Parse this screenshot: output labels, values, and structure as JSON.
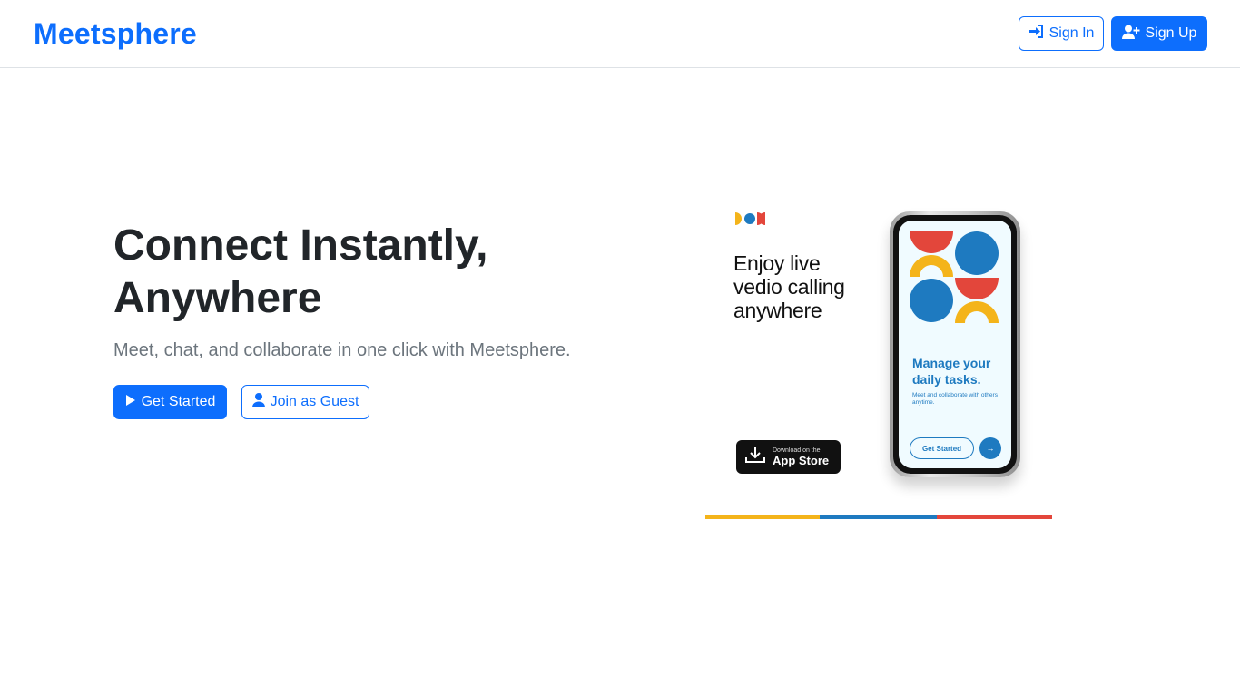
{
  "header": {
    "brand": "Meetsphere",
    "sign_in_label": "Sign In",
    "sign_up_label": "Sign Up"
  },
  "hero": {
    "title_line1": "Connect Instantly,",
    "title_line2": "Anywhere",
    "subtitle": "Meet, chat, and collaborate in one click with Meetsphere.",
    "get_started_label": "Get Started",
    "join_guest_label": "Join as Guest"
  },
  "promo": {
    "heading_line1": "Enjoy live",
    "heading_line2": "vedio calling",
    "heading_line3": "anywhere",
    "appstore_small": "Download on the",
    "appstore_big": "App Store",
    "screen_title": "Manage your daily tasks.",
    "screen_text": "Meet and collaborate with others anytime.",
    "screen_button": "Get Started",
    "screen_arrow": "→"
  },
  "colors": {
    "primary": "#0d6efd",
    "yellow": "#f4b41a",
    "blue": "#1e7ac0",
    "red": "#e3463b"
  },
  "icons": {
    "sign_in": "sign-in-icon",
    "sign_up": "user-plus-icon",
    "get_started": "play-icon",
    "join_guest": "user-icon",
    "download": "download-icon"
  }
}
